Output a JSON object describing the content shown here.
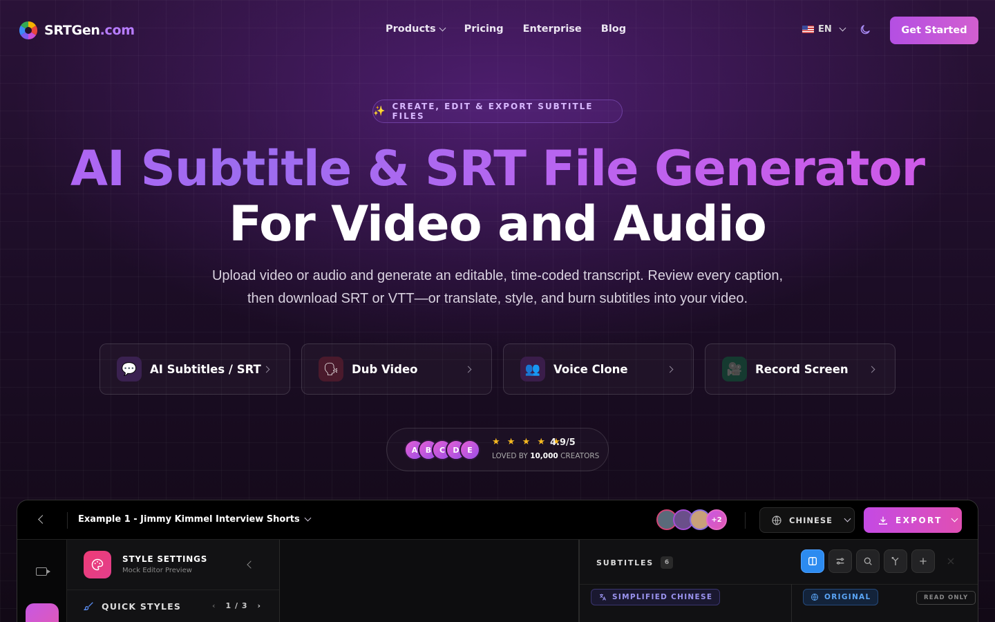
{
  "brand": {
    "name": "SRTGen",
    "domain": ".com",
    "accent": "#b77cff"
  },
  "nav": {
    "items": [
      {
        "label": "Products",
        "has_dropdown": true
      },
      {
        "label": "Pricing"
      },
      {
        "label": "Enterprise"
      },
      {
        "label": "Blog"
      }
    ],
    "language": "EN",
    "cta": "Get Started"
  },
  "hero": {
    "badge_icon": "✨",
    "badge": "CREATE, EDIT & EXPORT SUBTITLE FILES",
    "title_line1": "AI Subtitle & SRT File Generator",
    "title_line2": "For Video and Audio",
    "subtitle_line1": "Upload video or audio and generate an editable, time-coded transcript. Review every caption,",
    "subtitle_line2": "then download SRT or VTT—or translate, style, and burn subtitles into your video."
  },
  "features": [
    {
      "label": "AI Subtitles / SRT",
      "icon": "💬",
      "icon_name": "speech-bubble-icon",
      "bg": "#3a2150"
    },
    {
      "label": "Dub Video",
      "icon": "🗣",
      "icon_name": "speaking-head-icon",
      "bg": "#4a1a2c"
    },
    {
      "label": "Voice Clone",
      "icon": "👥",
      "icon_name": "people-icon",
      "bg": "#3a1d4a"
    },
    {
      "label": "Record Screen",
      "icon": "🎥",
      "icon_name": "video-camera-icon",
      "bg": "#153a30"
    }
  ],
  "rating": {
    "avatars": [
      "A",
      "B",
      "C",
      "D",
      "E"
    ],
    "stars": "★ ★ ★ ★ ★",
    "score": "4.9/5",
    "loved_prefix": "LOVED BY",
    "loved_count": "10,000",
    "loved_suffix": "CREATORS"
  },
  "editor": {
    "project_title": "Example 1 - Jimmy Kimmel Interview Shorts",
    "collaborators_extra": "+2",
    "language": "CHINESE",
    "export": "EXPORT",
    "style_title": "STYLE SETTINGS",
    "style_subtitle": "Mock Editor Preview",
    "quick_styles": "QUICK STYLES",
    "quick_styles_page": "1 / 3",
    "subtitles_label": "SUBTITLES",
    "subtitles_count": "6",
    "target_lang": "SIMPLIFIED CHINESE",
    "original_label": "ORIGINAL",
    "read_only": "READ ONLY"
  }
}
